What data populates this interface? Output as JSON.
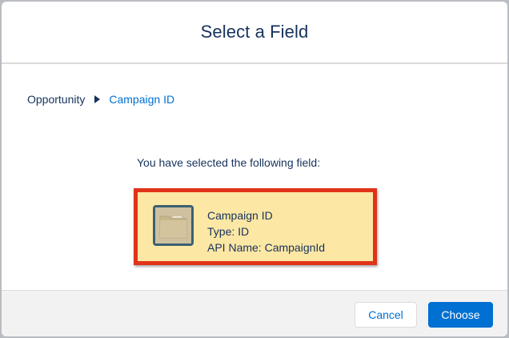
{
  "modal": {
    "title": "Select a Field"
  },
  "breadcrumb": {
    "root": "Opportunity",
    "current": "Campaign ID"
  },
  "selection": {
    "intro": "You have selected the following field:",
    "field_name": "Campaign ID",
    "type_line": "Type: ID",
    "api_line": "API Name: CampaignId",
    "icon": "folder-icon"
  },
  "footer": {
    "cancel_label": "Cancel",
    "choose_label": "Choose"
  },
  "colors": {
    "title": "#16325c",
    "link": "#0070d2",
    "primary_button": "#0070d2",
    "highlight_border": "#e03319",
    "card_fill": "#fde7a5"
  }
}
